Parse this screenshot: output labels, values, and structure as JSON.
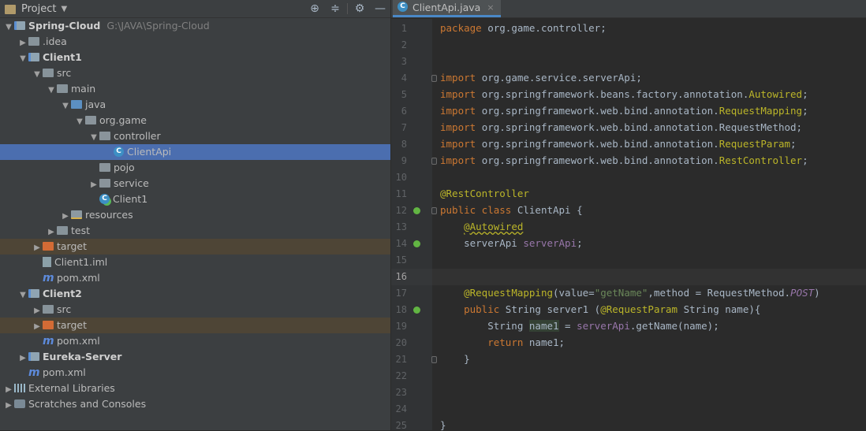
{
  "project_panel": {
    "title": "Project",
    "tools": [
      "locate-icon",
      "collapse-icon",
      "gear-icon",
      "minimize-icon"
    ],
    "tree": [
      {
        "depth": 0,
        "arrow": "down",
        "icon": "folder-module",
        "label": "Spring-Cloud",
        "bold": true,
        "path": "G:\\JAVA\\Spring-Cloud"
      },
      {
        "depth": 1,
        "arrow": "right",
        "icon": "folder",
        "label": ".idea"
      },
      {
        "depth": 1,
        "arrow": "down",
        "icon": "folder-module",
        "label": "Client1",
        "bold": true
      },
      {
        "depth": 2,
        "arrow": "down",
        "icon": "folder",
        "label": "src"
      },
      {
        "depth": 3,
        "arrow": "down",
        "icon": "folder",
        "label": "main"
      },
      {
        "depth": 4,
        "arrow": "down",
        "icon": "folder-src",
        "label": "java"
      },
      {
        "depth": 5,
        "arrow": "down",
        "icon": "folder-pkg",
        "label": "org.game"
      },
      {
        "depth": 6,
        "arrow": "down",
        "icon": "folder-pkg",
        "label": "controller"
      },
      {
        "depth": 7,
        "arrow": "none",
        "icon": "class",
        "label": "ClientApi",
        "selected": true
      },
      {
        "depth": 6,
        "arrow": "none",
        "icon": "folder-pkg",
        "label": "pojo"
      },
      {
        "depth": 6,
        "arrow": "right",
        "icon": "folder-pkg",
        "label": "service"
      },
      {
        "depth": 6,
        "arrow": "none",
        "icon": "class-run",
        "label": "Client1"
      },
      {
        "depth": 4,
        "arrow": "right",
        "icon": "folder-res",
        "label": "resources"
      },
      {
        "depth": 3,
        "arrow": "right",
        "icon": "folder",
        "label": "test"
      },
      {
        "depth": 2,
        "arrow": "right",
        "icon": "folder-excl",
        "label": "target",
        "excluded": true
      },
      {
        "depth": 2,
        "arrow": "none",
        "icon": "iml",
        "label": "Client1.iml"
      },
      {
        "depth": 2,
        "arrow": "none",
        "icon": "maven",
        "label": "pom.xml"
      },
      {
        "depth": 1,
        "arrow": "down",
        "icon": "folder-module",
        "label": "Client2",
        "bold": true
      },
      {
        "depth": 2,
        "arrow": "right",
        "icon": "folder",
        "label": "src"
      },
      {
        "depth": 2,
        "arrow": "right",
        "icon": "folder-excl",
        "label": "target",
        "excluded": true
      },
      {
        "depth": 2,
        "arrow": "none",
        "icon": "maven",
        "label": "pom.xml"
      },
      {
        "depth": 1,
        "arrow": "right",
        "icon": "folder-module",
        "label": "Eureka-Server",
        "bold": true
      },
      {
        "depth": 1,
        "arrow": "none",
        "icon": "maven",
        "label": "pom.xml"
      },
      {
        "depth": 0,
        "arrow": "right",
        "icon": "libs",
        "label": "External Libraries"
      },
      {
        "depth": 0,
        "arrow": "right",
        "icon": "scratch",
        "label": "Scratches and Consoles"
      }
    ]
  },
  "editor": {
    "tab": {
      "label": "ClientApi.java",
      "close": "×"
    },
    "lines": [
      [
        [
          "kw",
          "package "
        ],
        [
          "",
          "org.game.controller;"
        ]
      ],
      [],
      [],
      [
        [
          "kw",
          "import "
        ],
        [
          "",
          "org.game.service.serverApi;"
        ]
      ],
      [
        [
          "kw",
          "import "
        ],
        [
          "",
          "org.springframework.beans.factory.annotation."
        ],
        [
          "ann",
          "Autowired"
        ],
        [
          "",
          ";"
        ]
      ],
      [
        [
          "kw",
          "import "
        ],
        [
          "",
          "org.springframework.web.bind.annotation."
        ],
        [
          "ann",
          "RequestMapping"
        ],
        [
          "",
          ";"
        ]
      ],
      [
        [
          "kw",
          "import "
        ],
        [
          "",
          "org.springframework.web.bind.annotation.RequestMethod;"
        ]
      ],
      [
        [
          "kw",
          "import "
        ],
        [
          "",
          "org.springframework.web.bind.annotation."
        ],
        [
          "ann",
          "RequestParam"
        ],
        [
          "",
          ";"
        ]
      ],
      [
        [
          "kw",
          "import "
        ],
        [
          "",
          "org.springframework.web.bind.annotation."
        ],
        [
          "ann",
          "RestController"
        ],
        [
          "",
          ";"
        ]
      ],
      [],
      [
        [
          "ann",
          "@RestController"
        ]
      ],
      [
        [
          "kw",
          "public class "
        ],
        [
          "",
          "ClientApi {"
        ]
      ],
      [
        [
          "",
          "    "
        ],
        [
          "ann wave",
          "@Autowired"
        ]
      ],
      [
        [
          "",
          "    serverApi "
        ],
        [
          "fld",
          "serverApi"
        ],
        [
          "",
          ";"
        ]
      ],
      [],
      [],
      [
        [
          "",
          "    "
        ],
        [
          "ann",
          "@RequestMapping"
        ],
        [
          "",
          "(value="
        ],
        [
          "str",
          "\"getName\""
        ],
        [
          "",
          ",method = RequestMethod."
        ],
        [
          "itl",
          "POST"
        ],
        [
          "",
          ")"
        ]
      ],
      [
        [
          "",
          "    "
        ],
        [
          "kw",
          "public "
        ],
        [
          "",
          "String server1 ("
        ],
        [
          "ann",
          "@RequestParam "
        ],
        [
          "",
          "String name){"
        ]
      ],
      [
        [
          "",
          "        String "
        ],
        [
          "marked",
          "name1"
        ],
        [
          "",
          " = "
        ],
        [
          "fld",
          "serverApi"
        ],
        [
          "",
          ".getName(name);"
        ]
      ],
      [
        [
          "",
          "        "
        ],
        [
          "kw",
          "return "
        ],
        [
          "",
          "name1;"
        ]
      ],
      [
        [
          "",
          "    }"
        ]
      ],
      [],
      [],
      [],
      [
        [
          "",
          "}"
        ]
      ]
    ],
    "current_line": 16
  }
}
